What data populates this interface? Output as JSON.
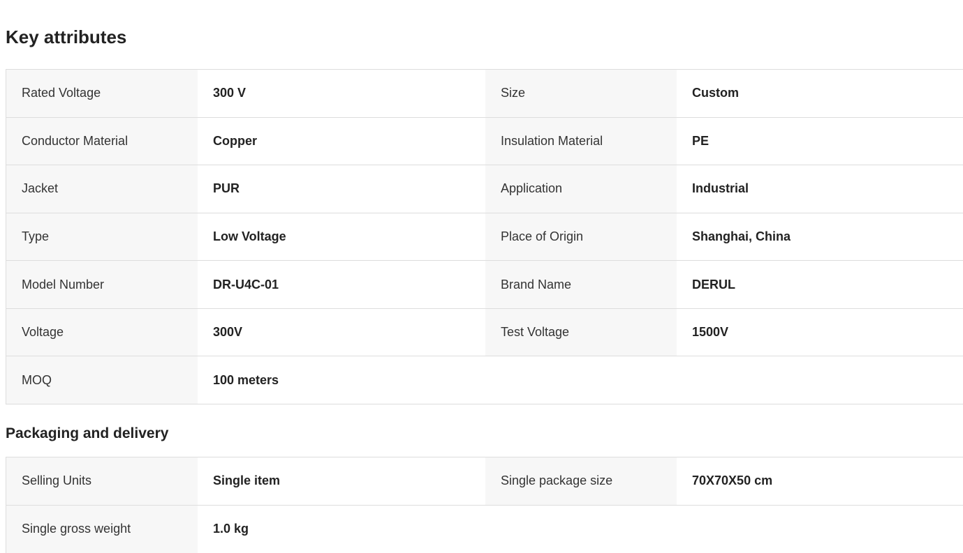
{
  "key_attributes": {
    "title": "Key attributes",
    "rows": [
      {
        "name1": "Rated Voltage",
        "value1": "300 V",
        "name2": "Size",
        "value2": "Custom"
      },
      {
        "name1": "Conductor Material",
        "value1": "Copper",
        "name2": "Insulation Material",
        "value2": "PE"
      },
      {
        "name1": "Jacket",
        "value1": "PUR",
        "name2": "Application",
        "value2": "Industrial"
      },
      {
        "name1": "Type",
        "value1": "Low Voltage",
        "name2": "Place of Origin",
        "value2": "Shanghai, China"
      },
      {
        "name1": "Model Number",
        "value1": "DR-U4C-01",
        "name2": "Brand Name",
        "value2": "DERUL"
      },
      {
        "name1": "Voltage",
        "value1": "300V",
        "name2": "Test Voltage",
        "value2": "1500V"
      },
      {
        "name1": "MOQ",
        "value1": "100 meters"
      }
    ]
  },
  "packaging": {
    "title": "Packaging and delivery",
    "rows": [
      {
        "name1": "Selling Units",
        "value1": "Single item",
        "name2": "Single package size",
        "value2": "70X70X50 cm"
      },
      {
        "name1": "Single gross weight",
        "value1": "1.0 kg"
      }
    ]
  }
}
